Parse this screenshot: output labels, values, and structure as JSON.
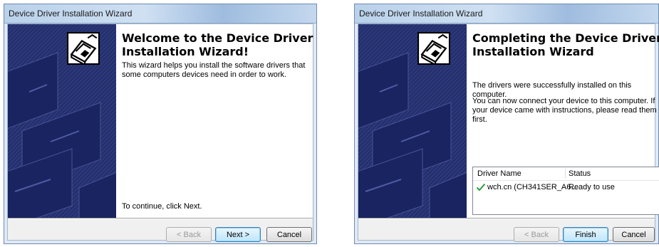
{
  "welcome": {
    "title": "Device Driver Installation Wizard",
    "heading_line1": "Welcome to the Device Driver",
    "heading_line2": "Installation Wizard!",
    "description": "This wizard helps you install the software drivers that some computers devices need in order to work.",
    "instruction": "To continue, click Next.",
    "buttons": {
      "back": "< Back",
      "next": "Next >",
      "cancel": "Cancel"
    }
  },
  "complete": {
    "title": "Device Driver Installation Wizard",
    "heading_line1": "Completing the Device Driver",
    "heading_line2": "Installation Wizard",
    "status_message": "The drivers were successfully installed on this computer.",
    "connect_message": "You can now connect your device to this computer. If your device came with instructions, please read them first.",
    "table": {
      "columns": [
        "Driver Name",
        "Status"
      ],
      "rows": [
        {
          "icon": "checkmark-icon",
          "name": "wch.cn (CH341SER_A6...",
          "status": "Ready to use"
        }
      ]
    },
    "buttons": {
      "back": "< Back",
      "finish": "Finish",
      "cancel": "Cancel"
    }
  },
  "colors": {
    "banner": "#1e2a66",
    "check": "#2e9e3c",
    "default_button": "#3c7fb1"
  }
}
